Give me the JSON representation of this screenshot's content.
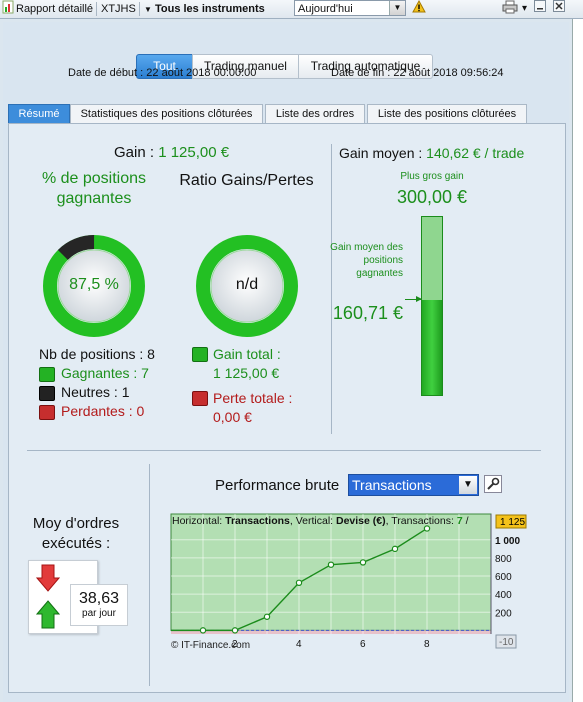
{
  "toolbar": {
    "report_label": "Rapport détaillé",
    "account_label": "XTJHS",
    "instruments_label": "Tous les instruments",
    "period_value": "Aujourd'hui"
  },
  "filter": {
    "buttons": [
      "Tout",
      "Trading manuel",
      "Trading automatique"
    ],
    "start_label": "Date de début :",
    "start_value": "22 août 2018 00:00:00",
    "end_label": "Date de fin :",
    "end_value": "22 août 2018 09:56:24"
  },
  "tabs": [
    "Résumé",
    "Statistiques des positions clôturées",
    "Liste des ordres",
    "Liste des positions clôturées"
  ],
  "summary": {
    "gain_label": "Gain :",
    "gain_value": "1 125,00 €",
    "pct_title": "% de positions gagnantes",
    "pct_value": "87,5 %",
    "win_fraction": 0.875,
    "ratio_title": "Ratio Gains/Pertes",
    "ratio_value": "n/d",
    "nb_positions": "Nb de positions : 8",
    "gagnantes": "Gagnantes : 7",
    "neutres": "Neutres : 1",
    "perdantes": "Perdantes : 0",
    "gain_total_label": "Gain total :",
    "gain_total_value": "1 125,00 €",
    "perte_totale_label": "Perte totale :",
    "perte_totale_value": "0,00 €",
    "gain_moyen_label": "Gain moyen :",
    "gain_moyen_value": "140,62 € / trade",
    "plus_gros_label": "Plus gros gain",
    "plus_gros_value": "300,00 €",
    "gain_moyen_pos_label": "Gain moyen des positions gagnantes",
    "gain_moyen_pos_value": "160,71 €",
    "bar_fraction": 0.5357
  },
  "orders": {
    "title": "Moy d'ordres exécutés :",
    "value": "38,63",
    "unit": "par jour"
  },
  "perf": {
    "title": "Performance brute",
    "select_value": "Transactions",
    "caption_prefix": "Horizontal: ",
    "caption_h": "Transactions",
    "caption_mid": ", Vertical: ",
    "caption_v": "Devise (€)",
    "caption_suffix": ", Transactions: ",
    "caption_count": "7",
    "caption_tail": " / ",
    "current_tag": "1 125",
    "low_tag": "-10",
    "watermark": "© IT-Finance.com"
  },
  "chart_data": {
    "type": "line",
    "x": [
      0,
      1,
      2,
      3,
      4,
      5,
      6,
      7,
      8
    ],
    "values": [
      0,
      0,
      0,
      150,
      525,
      725,
      750,
      900,
      1125
    ],
    "xticks": [
      "2",
      "4",
      "6",
      "8"
    ],
    "yticks": [
      "1 000",
      "800",
      "600",
      "400",
      "200"
    ],
    "xlim": [
      0,
      10
    ],
    "ylim": [
      -40,
      1130
    ],
    "colors": {
      "line": "#1c8c1c",
      "area": "#b3dfb3",
      "neg": "#e7c2cb"
    }
  }
}
